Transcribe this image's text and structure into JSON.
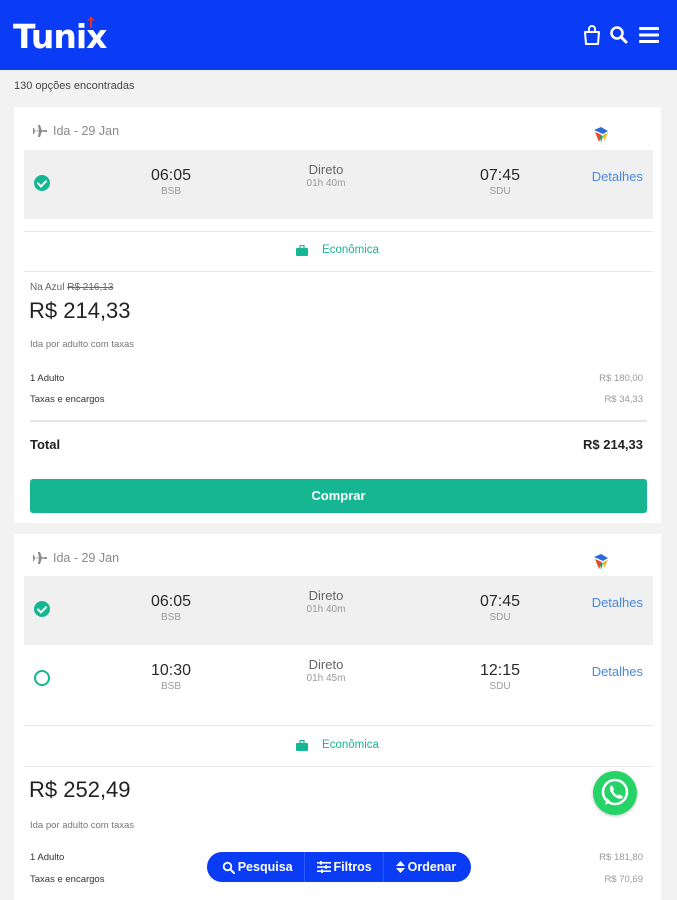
{
  "header": {
    "logo_text": "Tunix",
    "icons": [
      "bag-icon",
      "search-icon",
      "menu-icon"
    ],
    "color": "#0a3cf5"
  },
  "results_count": "130 opções encontradas",
  "accent_color": "#17b692",
  "offers": [
    {
      "segment_label": "Ida - 29 Jan",
      "flights": [
        {
          "selected": true,
          "depart_time": "06:05",
          "depart_airport": "BSB",
          "stops": "Direto",
          "duration": "01h 40m",
          "arrive_time": "07:45",
          "arrive_airport": "SDU",
          "details_label": "Detalhes"
        }
      ],
      "cabin": "Econômica",
      "old_price_label": "Na Azul",
      "old_price": "R$ 216,13",
      "price": "R$ 214,33",
      "price_note": "Ida por adulto com taxas",
      "breakdown": [
        {
          "label": "1 Adulto",
          "value": "R$ 180,00"
        },
        {
          "label": "Taxas e encargos",
          "value": "R$ 34,33"
        }
      ],
      "total_label": "Total",
      "total_value": "R$ 214,33",
      "buy_label": "Comprar"
    },
    {
      "segment_label": "Ida - 29 Jan",
      "flights": [
        {
          "selected": true,
          "depart_time": "06:05",
          "depart_airport": "BSB",
          "stops": "Direto",
          "duration": "01h 40m",
          "arrive_time": "07:45",
          "arrive_airport": "SDU",
          "details_label": "Detalhes"
        },
        {
          "selected": false,
          "depart_time": "10:30",
          "depart_airport": "BSB",
          "stops": "Direto",
          "duration": "01h 45m",
          "arrive_time": "12:15",
          "arrive_airport": "SDU",
          "details_label": "Detalhes"
        }
      ],
      "cabin": "Econômica",
      "price": "R$ 252,49",
      "price_note": "Ida por adulto com taxas",
      "breakdown": [
        {
          "label": "1 Adulto",
          "value": "R$ 181,80"
        },
        {
          "label": "Taxas e encargos",
          "value": "R$ 70,69"
        }
      ]
    }
  ],
  "bottom_bar": {
    "search_label": "Pesquisa",
    "filters_label": "Filtros",
    "sort_label": "Ordenar"
  }
}
